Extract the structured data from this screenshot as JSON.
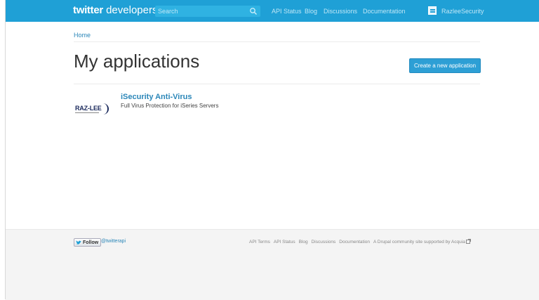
{
  "header": {
    "logo_bold": "twitter",
    "logo_rest": "developers",
    "search_placeholder": "Search",
    "nav": [
      "API Status",
      "Blog",
      "Discussions",
      "Documentation"
    ],
    "user_name": "RazleeSecurity"
  },
  "breadcrumb": {
    "home": "Home"
  },
  "main": {
    "title": "My applications",
    "create_button": "Create a new application",
    "apps": [
      {
        "logo_text": "RAZ-LEE",
        "name": "iSecurity Anti-Virus",
        "description": "Full Virus Protection for iSeries Servers"
      }
    ]
  },
  "footer": {
    "follow_label": "Follow",
    "follow_handle": "@twitterapi",
    "links": [
      "API Terms",
      "API Status",
      "Blog",
      "Discussions",
      "Documentation"
    ],
    "drupal_note": "A Drupal community site supported by Acquia"
  },
  "colors": {
    "topbar": "#1fa0d6",
    "link": "#2a86b8",
    "button": "#2d9fd5",
    "footer_bg": "#f4f4f4"
  }
}
